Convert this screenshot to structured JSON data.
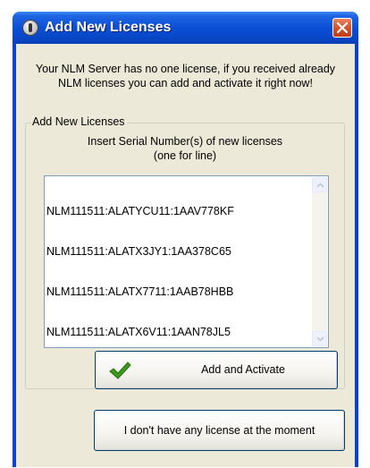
{
  "window": {
    "title": "Add New Licenses"
  },
  "intro_text": "Your NLM Server has no one license, if you received already NLM licenses you can add and activate it right now!",
  "group": {
    "legend": "Add New Licenses",
    "instructions_line1": "Insert Serial Number(s) of new licenses",
    "instructions_line2": "(one for line)"
  },
  "serials": [
    "NLM111511:ALATYCU11:1AAV778KF",
    "NLM111511:ALATX3JY1:1AA378C65",
    "NLM111511:ALATX7711:1AAB78HBB",
    "NLM111511:ALATX6V11:1AAN78JL5"
  ],
  "buttons": {
    "add_activate": "Add and Activate",
    "no_license": "I don't have any license at the moment"
  },
  "icons": {
    "app": "broadcast-antenna-icon",
    "close": "close-icon",
    "activate": "checkmark-icon"
  },
  "colors": {
    "titlebar": "#0a4fd6",
    "close_button": "#d6532b",
    "dialog_background": "#ece9d8",
    "checkmark": "#3a9a1c"
  }
}
